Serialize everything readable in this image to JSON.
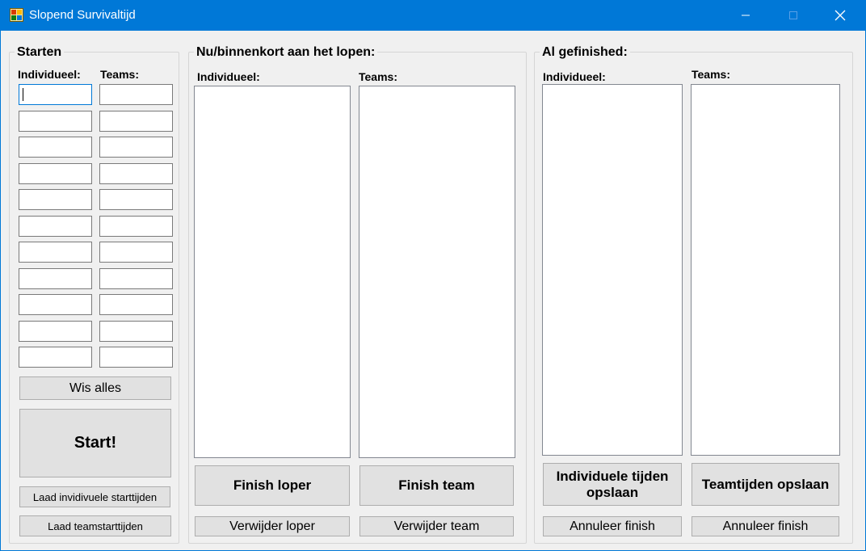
{
  "window": {
    "title": "Slopend Survivaltijd"
  },
  "starten": {
    "title": "Starten",
    "individual_label": "Individueel:",
    "teams_label": "Teams:",
    "wis_alles": "Wis alles",
    "start": "Start!",
    "laad_individueel": "Laad invidivuele starttijden",
    "laad_teams": "Laad teamstarttijden"
  },
  "lopen": {
    "title": "Nu/binnenkort aan het lopen:",
    "individual_label": "Individueel:",
    "teams_label": "Teams:",
    "finish_loper": "Finish loper",
    "finish_team": "Finish team",
    "verwijder_loper": "Verwijder loper",
    "verwijder_team": "Verwijder team"
  },
  "gefinished": {
    "title": "Al gefinished:",
    "individual_label": "Individueel:",
    "teams_label": "Teams:",
    "individuele_opslaan": "Individuele tijden opslaan",
    "team_opslaan": "Teamtijden opslaan",
    "annuleer_individueel": "Annuleer finish",
    "annuleer_team": "Annuleer finish"
  }
}
